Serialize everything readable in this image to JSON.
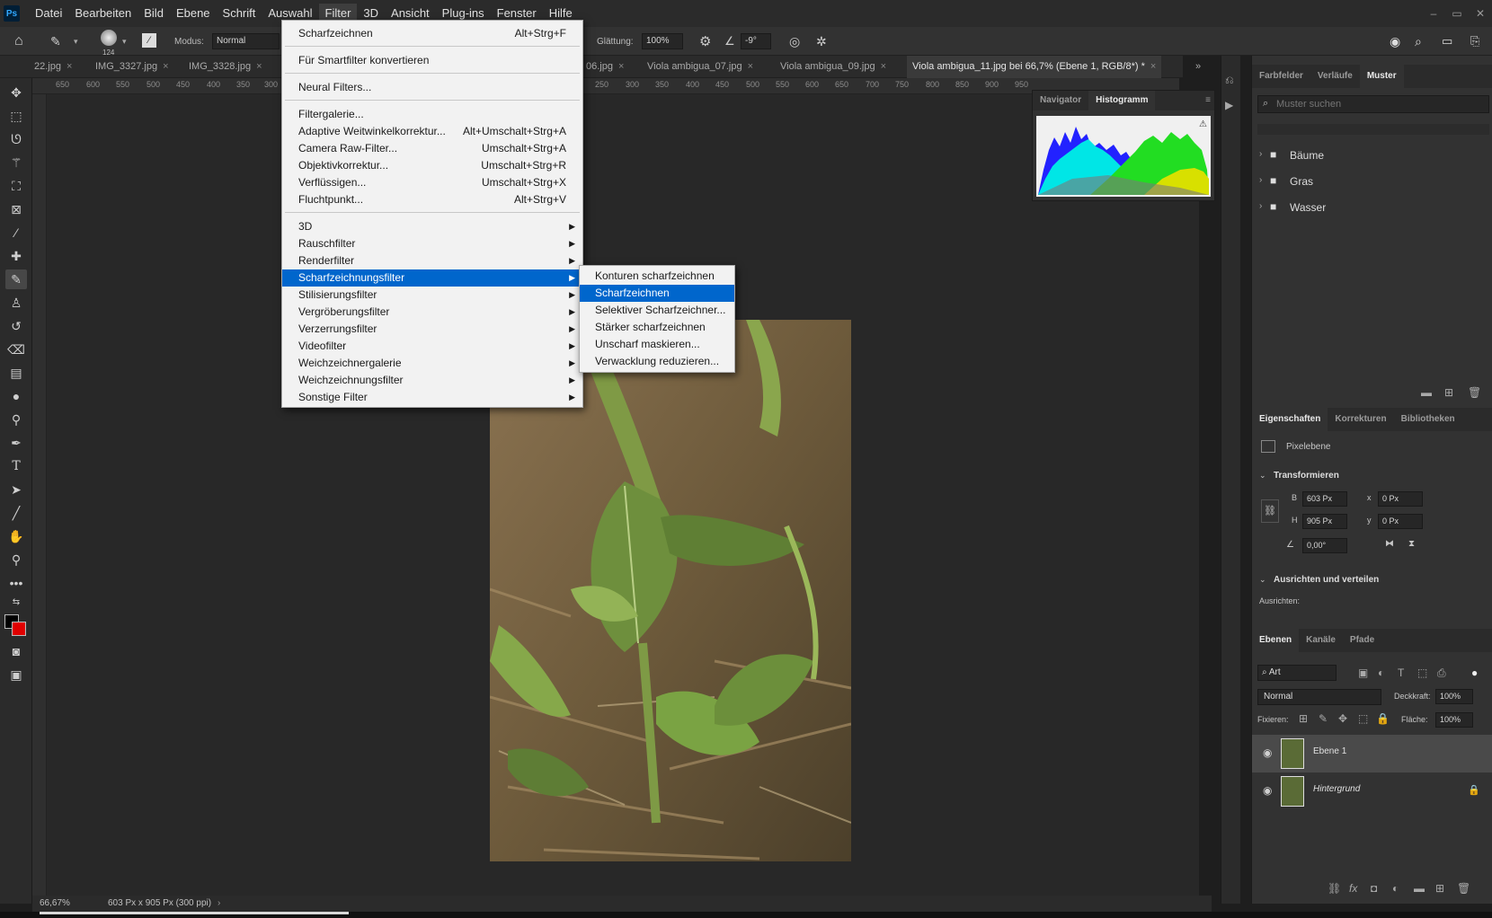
{
  "app": {
    "logo": "Ps"
  },
  "menubar": {
    "items": [
      "Datei",
      "Bearbeiten",
      "Bild",
      "Ebene",
      "Schrift",
      "Auswahl",
      "Filter",
      "3D",
      "Ansicht",
      "Plug-ins",
      "Fenster",
      "Hilfe"
    ],
    "active": "Filter"
  },
  "window_controls": {
    "minimize": "–",
    "restore": "▭",
    "close": "✕"
  },
  "options": {
    "brush_size": "124",
    "mode_label": "Modus:",
    "mode_value": "Normal",
    "smoothing_label": "Glättung:",
    "smoothing_value": "100%",
    "angle_value": "-9°"
  },
  "tabs": [
    {
      "label": "22.jpg"
    },
    {
      "label": "IMG_3327.jpg"
    },
    {
      "label": "IMG_3328.jpg"
    },
    {
      "label": "06.jpg"
    },
    {
      "label": "Viola ambigua_07.jpg"
    },
    {
      "label": "Viola ambigua_09.jpg"
    },
    {
      "label": "Viola ambigua_11.jpg bei 66,7% (Ebene 1, RGB/8*) *"
    }
  ],
  "ruler": {
    "left_ticks": [
      "650",
      "600",
      "550",
      "500",
      "450",
      "400",
      "350",
      "300"
    ],
    "right_ticks": [
      "250",
      "300",
      "350",
      "400",
      "450",
      "500",
      "550",
      "600",
      "650",
      "700",
      "750",
      "800",
      "850",
      "900",
      "950"
    ]
  },
  "filter_menu": {
    "items": [
      {
        "label": "Scharfzeichnen",
        "shortcut": "Alt+Strg+F"
      },
      {
        "label": "Für Smartfilter konvertieren",
        "shortcut": ""
      },
      {
        "label": "Neural Filters...",
        "shortcut": ""
      },
      {
        "label": "Filtergalerie...",
        "shortcut": ""
      },
      {
        "label": "Adaptive Weitwinkelkorrektur...",
        "shortcut": "Alt+Umschalt+Strg+A"
      },
      {
        "label": "Camera Raw-Filter...",
        "shortcut": "Umschalt+Strg+A"
      },
      {
        "label": "Objektivkorrektur...",
        "shortcut": "Umschalt+Strg+R"
      },
      {
        "label": "Verflüssigen...",
        "shortcut": "Umschalt+Strg+X"
      },
      {
        "label": "Fluchtpunkt...",
        "shortcut": "Alt+Strg+V"
      },
      {
        "label": "3D",
        "shortcut": ""
      },
      {
        "label": "Rauschfilter",
        "shortcut": ""
      },
      {
        "label": "Renderfilter",
        "shortcut": ""
      },
      {
        "label": "Scharfzeichnungsfilter",
        "shortcut": ""
      },
      {
        "label": "Stilisierungsfilter",
        "shortcut": ""
      },
      {
        "label": "Vergröberungsfilter",
        "shortcut": ""
      },
      {
        "label": "Verzerrungsfilter",
        "shortcut": ""
      },
      {
        "label": "Videofilter",
        "shortcut": ""
      },
      {
        "label": "Weichzeichnergalerie",
        "shortcut": ""
      },
      {
        "label": "Weichzeichnungsfilter",
        "shortcut": ""
      },
      {
        "label": "Sonstige Filter",
        "shortcut": ""
      }
    ],
    "highlighted": "Scharfzeichnungsfilter"
  },
  "sharpen_submenu": {
    "items": [
      "Konturen scharfzeichnen",
      "Scharfzeichnen",
      "Selektiver Scharfzeichner...",
      "Stärker scharfzeichnen",
      "Unscharf maskieren...",
      "Verwacklung reduzieren..."
    ],
    "highlighted": "Scharfzeichnen"
  },
  "histogram_panel": {
    "tabs": [
      "Navigator",
      "Histogramm"
    ],
    "active": "Histogramm"
  },
  "swatches_panel": {
    "tabs": [
      "Farbfelder",
      "Verläufe",
      "Muster"
    ],
    "active": "Muster",
    "search_placeholder": "Muster suchen",
    "folders": [
      "Bäume",
      "Gras",
      "Wasser"
    ]
  },
  "properties_panel": {
    "tabs": [
      "Eigenschaften",
      "Korrekturen",
      "Bibliotheken"
    ],
    "active": "Eigenschaften",
    "layer_type": "Pixelebene",
    "transform_title": "Transformieren",
    "w_label": "B",
    "w_value": "603 Px",
    "h_label": "H",
    "h_value": "905 Px",
    "x_label": "x",
    "x_value": "0 Px",
    "y_label": "y",
    "y_value": "0 Px",
    "angle_value": "0,00°",
    "align_title": "Ausrichten und verteilen",
    "align_label": "Ausrichten:"
  },
  "layers_panel": {
    "tabs": [
      "Ebenen",
      "Kanäle",
      "Pfade"
    ],
    "active": "Ebenen",
    "filter_kind": "Art",
    "blend_mode": "Normal",
    "opacity_label": "Deckkraft:",
    "opacity_value": "100%",
    "lock_label": "Fixieren:",
    "fill_label": "Fläche:",
    "fill_value": "100%",
    "layers": [
      {
        "name": "Ebene 1",
        "selected": true
      },
      {
        "name": "Hintergrund",
        "selected": false,
        "locked": true
      }
    ]
  },
  "status": {
    "zoom": "66,67%",
    "doc_info": "603 Px x 905 Px (300 ppi)",
    "arrow": "›"
  },
  "colors": {
    "ui_bg": "#323232",
    "menu_highlight": "#0066cc",
    "foreground_swatch": "#000000",
    "background_swatch": "#e00000"
  }
}
